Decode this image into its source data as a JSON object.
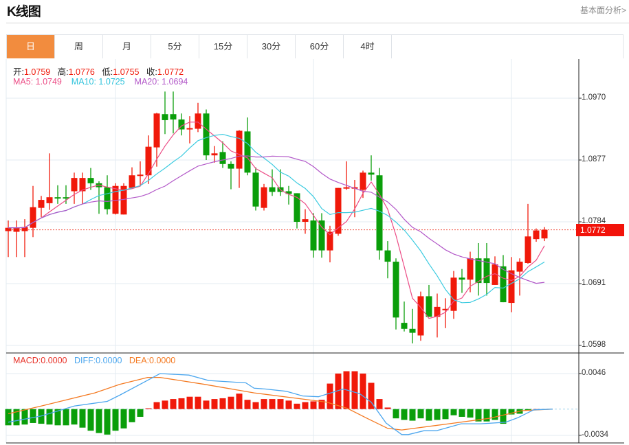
{
  "header": {
    "title": "K线图",
    "link": "基本面分析>"
  },
  "tabs": [
    {
      "label": "日",
      "active": true
    },
    {
      "label": "周"
    },
    {
      "label": "月"
    },
    {
      "label": "5分"
    },
    {
      "label": "15分"
    },
    {
      "label": "30分"
    },
    {
      "label": "60分"
    },
    {
      "label": "4时"
    }
  ],
  "info": {
    "open_label": "开:",
    "open": "1.0759",
    "high_label": "高:",
    "high": "1.0776",
    "low_label": "低:",
    "low": "1.0755",
    "close_label": "收:",
    "close": "1.0772",
    "ma5": "MA5: 1.0749",
    "ma10": "MA10: 1.0725",
    "ma20": "MA20: 1.0694"
  },
  "macd_info": {
    "macd": "MACD:0.0000",
    "diff": "DIFF:0.0000",
    "dea": "DEA:0.0000"
  },
  "current_price": "1.0772",
  "colors": {
    "up": "#f0190a",
    "down": "#0a9e0a",
    "ma5": "#ec4d86",
    "ma10": "#3ccbe0",
    "ma20": "#b257c8",
    "diff": "#4ba6ee",
    "dea": "#f47a22",
    "active_tab": "#f28c3e"
  },
  "chart_data": [
    {
      "type": "candlestick",
      "title": "K线图",
      "y_ticks": [
        "1.0970",
        "1.0877",
        "1.0784",
        "1.0691",
        "1.0598"
      ],
      "ylim": [
        1.0598,
        1.097
      ],
      "grid": true,
      "ohlc": [
        [
          1.077,
          1.0786,
          1.0731,
          1.0775
        ],
        [
          1.0769,
          1.0786,
          1.0731,
          1.0775
        ],
        [
          1.077,
          1.0788,
          1.0731,
          1.0776
        ],
        [
          1.0775,
          1.0838,
          1.0761,
          1.0806
        ],
        [
          1.0805,
          1.0823,
          1.0791,
          1.0817
        ],
        [
          1.0812,
          1.0887,
          1.0802,
          1.0821
        ],
        [
          1.0821,
          1.0839,
          1.0811,
          1.0819
        ],
        [
          1.0821,
          1.0839,
          1.0811,
          1.0819
        ],
        [
          1.083,
          1.0858,
          1.0811,
          1.085
        ],
        [
          1.083,
          1.0858,
          1.0811,
          1.085
        ],
        [
          1.085,
          1.0865,
          1.0832,
          1.0842
        ],
        [
          1.0842,
          1.0845,
          1.0796,
          1.0836
        ],
        [
          1.0836,
          1.0854,
          1.0795,
          1.0803
        ],
        [
          1.0796,
          1.0842,
          1.0795,
          1.0838
        ],
        [
          1.0795,
          1.0842,
          1.0795,
          1.0838
        ],
        [
          1.0835,
          1.0866,
          1.0835,
          1.0854
        ],
        [
          1.0853,
          1.0875,
          1.0839,
          1.0855
        ],
        [
          1.0854,
          1.0914,
          1.0841,
          1.0897
        ],
        [
          1.0896,
          1.0948,
          1.0867,
          1.0947
        ],
        [
          1.0946,
          1.098,
          1.0916,
          1.0937
        ],
        [
          1.0946,
          1.098,
          1.0917,
          1.0938
        ],
        [
          1.0938,
          1.0947,
          1.0914,
          1.0923
        ],
        [
          1.0923,
          1.0943,
          1.0902,
          1.0925
        ],
        [
          1.0924,
          1.0963,
          1.0919,
          1.0947
        ],
        [
          1.0947,
          1.0953,
          1.0877,
          1.0884
        ],
        [
          1.0884,
          1.0898,
          1.0873,
          1.0887
        ],
        [
          1.0889,
          1.0905,
          1.0865,
          1.0871
        ],
        [
          1.0871,
          1.0875,
          1.0833,
          1.0864
        ],
        [
          1.0864,
          1.0922,
          1.0835,
          1.0921
        ],
        [
          1.092,
          1.0941,
          1.0854,
          1.0858
        ],
        [
          1.0858,
          1.0866,
          1.0801,
          1.0807
        ],
        [
          1.0805,
          1.0841,
          1.0801,
          1.0836
        ],
        [
          1.0836,
          1.0863,
          1.0823,
          1.0829
        ],
        [
          1.0836,
          1.0863,
          1.0823,
          1.0829
        ],
        [
          1.083,
          1.0838,
          1.081,
          1.0826
        ],
        [
          1.0827,
          1.0827,
          1.0774,
          1.0784
        ],
        [
          1.0784,
          1.0803,
          1.0766,
          1.0788
        ],
        [
          1.0786,
          1.0797,
          1.073,
          1.0741
        ],
        [
          1.0786,
          1.0797,
          1.073,
          1.0741
        ],
        [
          1.0741,
          1.0778,
          1.0723,
          1.0769
        ],
        [
          1.0766,
          1.0835,
          1.0763,
          1.0835
        ],
        [
          1.0834,
          1.0875,
          1.0832,
          1.0836
        ],
        [
          1.0834,
          1.0847,
          1.0791,
          1.0836
        ],
        [
          1.0832,
          1.0861,
          1.082,
          1.0858
        ],
        [
          1.0858,
          1.0884,
          1.0846,
          1.0855
        ],
        [
          1.0854,
          1.0865,
          1.0727,
          1.0741
        ],
        [
          1.0741,
          1.0755,
          1.0699,
          1.0724
        ],
        [
          1.0724,
          1.0729,
          1.0622,
          1.064
        ],
        [
          1.0632,
          1.0664,
          1.0619,
          1.0623
        ],
        [
          1.0623,
          1.0653,
          1.0601,
          1.0617
        ],
        [
          1.0613,
          1.0679,
          1.0605,
          1.0672
        ],
        [
          1.0672,
          1.0689,
          1.0641,
          1.0641
        ],
        [
          1.0641,
          1.0676,
          1.061,
          1.0656
        ],
        [
          1.0651,
          1.0669,
          1.0624,
          1.0653
        ],
        [
          1.065,
          1.071,
          1.0638,
          1.07
        ],
        [
          1.07,
          1.0713,
          1.0677,
          1.0697
        ],
        [
          1.0697,
          1.0739,
          1.0678,
          1.0729
        ],
        [
          1.0729,
          1.0752,
          1.0673,
          1.0692
        ],
        [
          1.0729,
          1.0752,
          1.0673,
          1.0692
        ],
        [
          1.0689,
          1.0732,
          1.0689,
          1.072
        ],
        [
          1.0717,
          1.0734,
          1.0663,
          1.0663
        ],
        [
          1.0662,
          1.0731,
          1.0648,
          1.0711
        ],
        [
          1.0709,
          1.0729,
          1.0673,
          1.0724
        ],
        [
          1.0722,
          1.0811,
          1.0721,
          1.0762
        ],
        [
          1.0758,
          1.0774,
          1.0754,
          1.0771
        ],
        [
          1.0759,
          1.0776,
          1.0755,
          1.0772
        ]
      ],
      "ma_periods": [
        5,
        10,
        20
      ]
    },
    {
      "type": "macd",
      "y_ticks": [
        "0.0046",
        "-0.0034"
      ],
      "ylim": [
        -0.0034,
        0.0046
      ],
      "hist": [
        -0.0021,
        -0.0021,
        -0.002,
        -0.0018,
        -0.0019,
        -0.002,
        -0.0021,
        -0.0021,
        -0.002,
        -0.0024,
        -0.0028,
        -0.0031,
        -0.0033,
        -0.0028,
        -0.0025,
        -0.0017,
        -0.001,
        0.0001,
        0.0009,
        0.0011,
        0.0013,
        0.0014,
        0.0016,
        0.0016,
        0.0011,
        0.0013,
        0.0014,
        0.0016,
        0.002,
        0.0012,
        0.0009,
        0.0013,
        0.0013,
        0.0013,
        0.0011,
        0.0007,
        0.0009,
        0.001,
        0.0012,
        0.0033,
        0.0046,
        0.0049,
        0.0049,
        0.0046,
        0.0034,
        0.0013,
        0.0002,
        -0.0012,
        -0.0014,
        -0.0015,
        -0.0012,
        -0.0015,
        -0.0014,
        -0.0013,
        -0.0008,
        -0.001,
        -0.0011,
        -0.0016,
        -0.0016,
        -0.0014,
        -0.0019,
        -0.0007,
        -0.0006,
        -0.0002,
        0.0,
        0.0
      ],
      "diff": [
        [
          0,
          -0.0017
        ],
        [
          4,
          -0.0009
        ],
        [
          8,
          0.0004
        ],
        [
          12,
          0.001
        ],
        [
          13.5,
          0.0018
        ],
        [
          16.5,
          0.0035
        ],
        [
          18.4,
          0.0046
        ],
        [
          21.9,
          0.0044
        ],
        [
          24.3,
          0.0037
        ],
        [
          28.8,
          0.0034
        ],
        [
          29.8,
          0.0027
        ],
        [
          31.2,
          0.0026
        ],
        [
          33.7,
          0.0023
        ],
        [
          35.7,
          0.0017
        ],
        [
          37.6,
          0.0016
        ],
        [
          39.1,
          0.0021
        ],
        [
          40.6,
          0.0026
        ],
        [
          42.6,
          0.002
        ],
        [
          44,
          0.0009
        ],
        [
          45.8,
          -0.0018
        ],
        [
          47.7,
          -0.0033
        ],
        [
          48.5,
          -0.0033
        ],
        [
          50.4,
          -0.0028
        ],
        [
          51.9,
          -0.0028
        ],
        [
          54.9,
          -0.0019
        ],
        [
          57.3,
          -0.0019
        ],
        [
          60.3,
          -0.0017
        ],
        [
          61.8,
          -0.0011
        ],
        [
          63.7,
          -0.0001
        ],
        [
          66,
          0
        ]
      ],
      "dea": [
        [
          0,
          -0.0006
        ],
        [
          4,
          0.0004
        ],
        [
          10.5,
          0.0021
        ],
        [
          13.5,
          0.0032
        ],
        [
          16.9,
          0.0041
        ],
        [
          18.4,
          0.0041
        ],
        [
          23.8,
          0.0032
        ],
        [
          29.8,
          0.0021
        ],
        [
          35.7,
          0.0013
        ],
        [
          38.6,
          0.0009
        ],
        [
          41.1,
          0.0001
        ],
        [
          43.5,
          -0.0012
        ],
        [
          46,
          -0.0025
        ],
        [
          47.7,
          -0.0027
        ],
        [
          53.4,
          -0.0019
        ],
        [
          58.3,
          -0.0012
        ],
        [
          62.3,
          -0.0002
        ],
        [
          66,
          0
        ]
      ]
    }
  ]
}
